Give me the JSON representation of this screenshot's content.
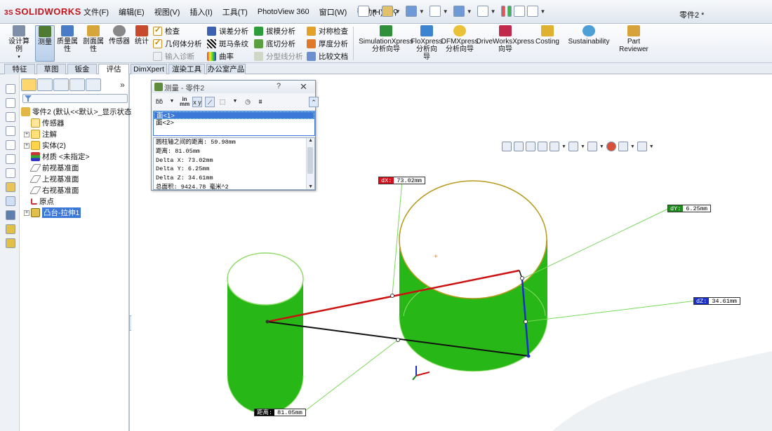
{
  "app": {
    "logo_prefix": "3S",
    "logo_text": "SOLIDWORKS",
    "document_title": "零件2 *"
  },
  "menu": [
    "文件(F)",
    "编辑(E)",
    "视图(V)",
    "插入(I)",
    "工具(T)",
    "PhotoView 360",
    "窗口(W)",
    "帮助(H)"
  ],
  "ribbon": {
    "large_buttons": [
      {
        "name": "design-study-button",
        "label": "设计算\n例"
      },
      {
        "name": "measure-button",
        "label": "测量"
      },
      {
        "name": "mass-properties-button",
        "label": "质量属\n性"
      },
      {
        "name": "section-properties-button",
        "label": "剖面属\n性"
      },
      {
        "name": "sensor-button",
        "label": "传感器"
      },
      {
        "name": "statistics-button",
        "label": "统计"
      }
    ],
    "col1": [
      "检查",
      "几何体分析",
      "输入诊断"
    ],
    "col2": [
      "误差分析",
      "斑马条纹",
      "曲率"
    ],
    "col3": [
      "拔模分析",
      "底切分析",
      "分型线分析"
    ],
    "col4": [
      "对称检查",
      "厚度分析",
      "比较文档"
    ],
    "xpress": [
      {
        "name": "simulationxpress-button",
        "label": "SimulationXpress\n分析向导"
      },
      {
        "name": "floxpress-button",
        "label": "FloXpress\n分析向\n导"
      },
      {
        "name": "dfmxpress-button",
        "label": "DFMXpress\n分析向导"
      },
      {
        "name": "driveworksxpress-button",
        "label": "DriveWorksXpress\n向导"
      },
      {
        "name": "costing-button",
        "label": "Costing"
      },
      {
        "name": "sustainability-button",
        "label": "Sustainability"
      },
      {
        "name": "part-reviewer-button",
        "label": "Part\nReviewer"
      }
    ]
  },
  "tabs": [
    "特征",
    "草图",
    "钣金",
    "评估",
    "DimXpert",
    "渲染工具",
    "办公室产品"
  ],
  "tree": {
    "root": "零件2 (默认<<默认>_显示状态",
    "items": [
      "传感器",
      "注解",
      "实体(2)",
      "材质 <未指定>",
      "前视基准面",
      "上视基准面",
      "右视基准面",
      "原点",
      "凸台-拉伸1"
    ]
  },
  "measure": {
    "title": "测量 - 零件2",
    "help": "?",
    "close": "✕",
    "unit_label_top": "in",
    "unit_label_bottom": "mm",
    "selections": [
      "面<1>",
      "面<2>"
    ],
    "results": [
      "圆柱轴之间的距离:  59.98mm",
      "距离: 81.05mm",
      "Delta X: 73.02mm",
      "Delta Y: 6.25mm",
      "Delta Z: 34.61mm",
      "总面积: 9424.78 毫米^2"
    ]
  },
  "callouts": {
    "dx": {
      "key": "dX:",
      "value": "73.02mm",
      "color": "#d4101a"
    },
    "dy": {
      "key": "dY:",
      "value": "6.25mm",
      "color": "#1e8a1e"
    },
    "dz": {
      "key": "dZ:",
      "value": "34.61mm",
      "color": "#1a2fc8"
    },
    "dist": {
      "key": "距离:",
      "value": "81.05mm",
      "color": "#000000"
    }
  },
  "colors": {
    "cylinder_green": "#27b818",
    "cylinder_edge": "#8fdc6a",
    "top_face_edge": "#b79a1c",
    "delta_x_line": "#cc1111",
    "delta_y_line": "#1a2fc8"
  }
}
